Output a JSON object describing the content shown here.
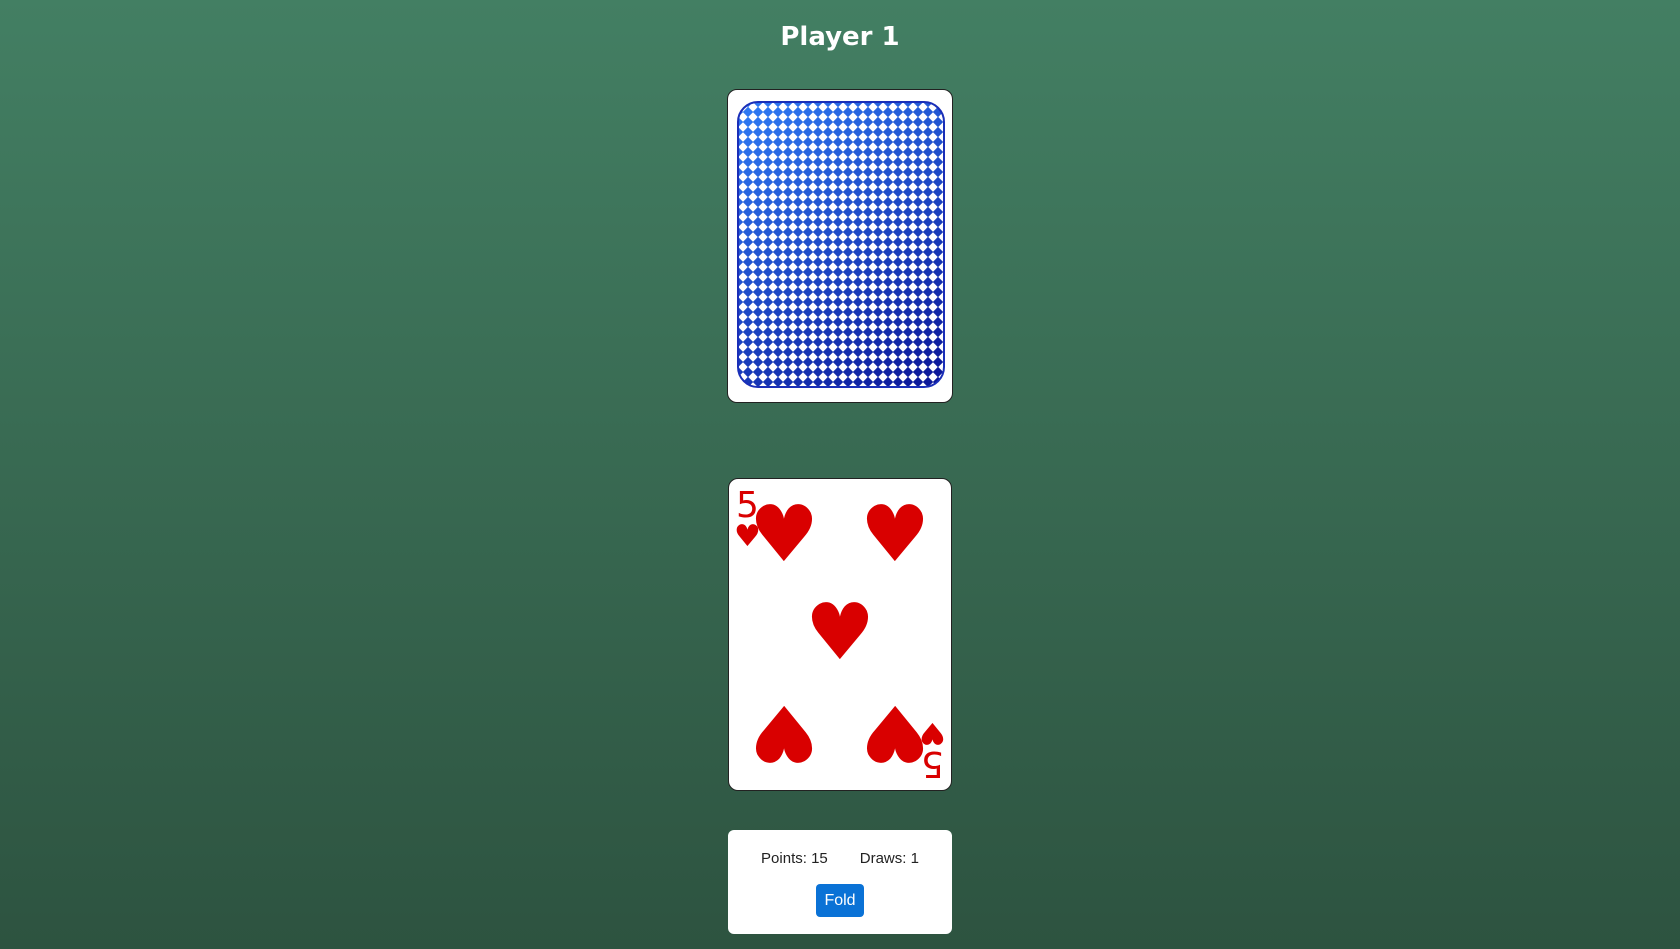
{
  "header": {
    "title": "Player 1"
  },
  "deck": {
    "state": "face-down",
    "back_colors": {
      "light": "#2f7cf6",
      "dark": "#0a1496",
      "border": "#1a2fb8"
    }
  },
  "card": {
    "rank": "5",
    "suit": "♥",
    "suit_name": "hearts",
    "color": "#d90000",
    "pips": 5
  },
  "stats": {
    "points_text": "Points: 15",
    "draws_text": "Draws: 1"
  },
  "controls": {
    "fold_label": "Fold",
    "fold_color": "#0a72d6"
  }
}
